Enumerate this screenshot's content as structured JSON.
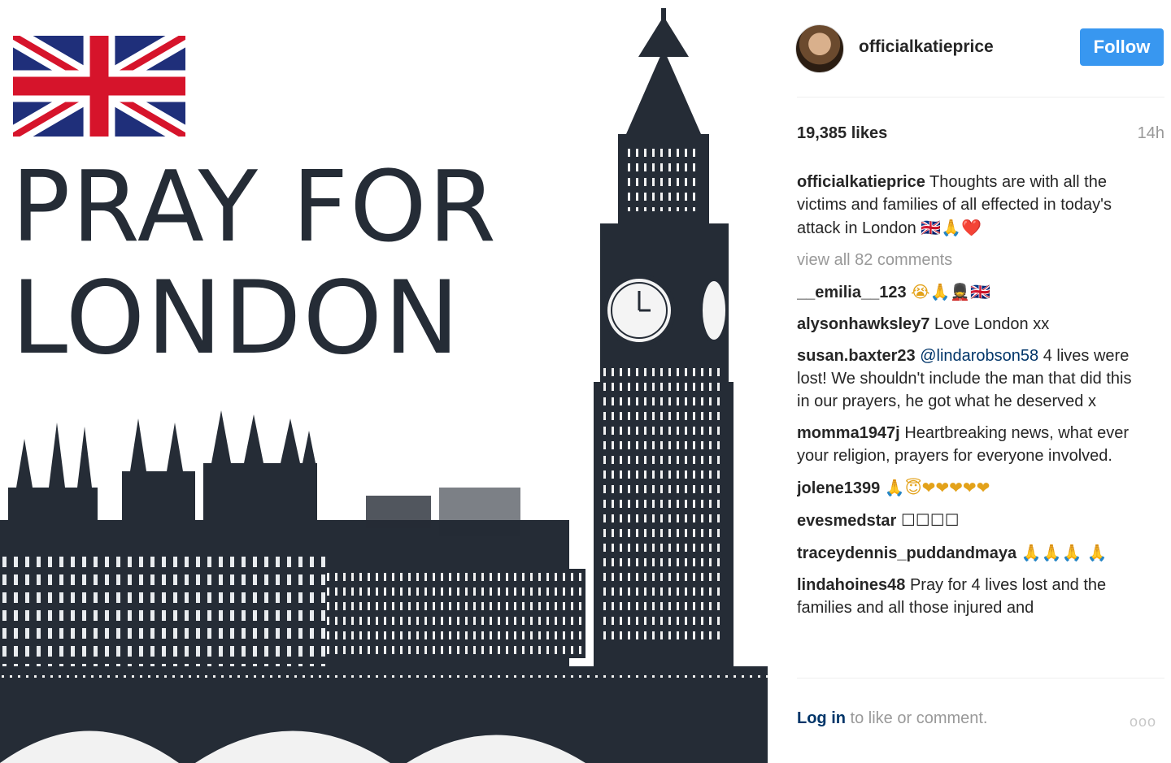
{
  "image": {
    "headline_line1": "PRAY FOR",
    "headline_line2": "LONDON",
    "flag_colors": {
      "blue": "#1f2f7a",
      "red": "#d6142b",
      "white": "#ffffff"
    },
    "ink_color": "#252c36"
  },
  "header": {
    "username": "officialkatieprice",
    "follow_label": "Follow",
    "accent": "#3897f0"
  },
  "stats": {
    "likes": "19,385 likes",
    "time": "14h"
  },
  "caption": {
    "user": "officialkatieprice",
    "text": "Thoughts are with all the victims and families of all effected in today's attack in London",
    "emoji": "🇬🇧🙏❤️"
  },
  "view_all": "view all 82 comments",
  "comments": [
    {
      "user": "__emilia__123",
      "text": "",
      "emoji": "😭🙏💂🇬🇧"
    },
    {
      "user": "alysonhawksley7",
      "text": "Love London xx",
      "emoji": ""
    },
    {
      "user": "susan.baxter23",
      "mention": "@lindarobson58",
      "text": "4 lives were lost! We shouldn't include the man that did this in our prayers, he got what he deserved x",
      "emoji": ""
    },
    {
      "user": "momma1947j",
      "text": "Heartbreaking news, what ever your religion, prayers for everyone involved.",
      "emoji": ""
    },
    {
      "user": "jolene1399",
      "text": "",
      "emoji": "🙏😇❤❤❤❤❤"
    },
    {
      "user": "evesmedstar",
      "text": "",
      "emoji": "☐☐☐☐"
    },
    {
      "user": "traceydennis_puddandmaya",
      "text": "",
      "emoji": "🙏🙏🙏 🙏"
    },
    {
      "user": "lindahoines48",
      "text": "Pray for 4 lives lost and the families and all those injured and",
      "emoji": ""
    }
  ],
  "footer": {
    "login": "Log in",
    "rest": "to like or comment.",
    "more": "ooo"
  }
}
